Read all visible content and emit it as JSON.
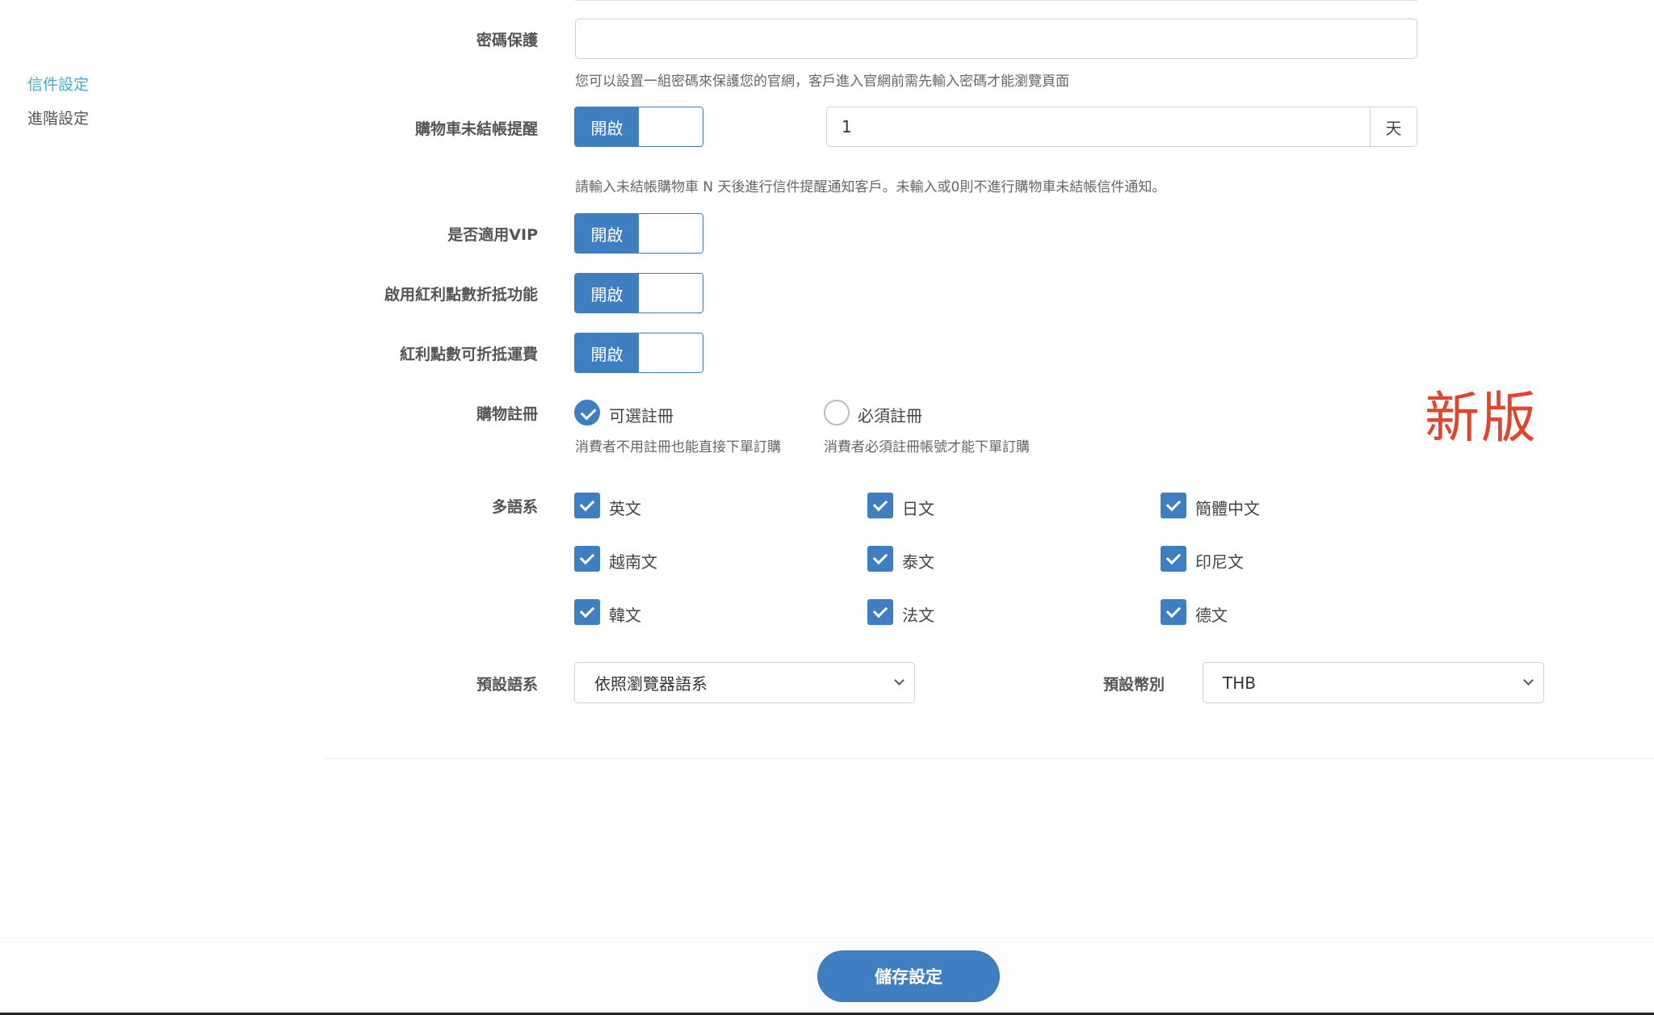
{
  "sidebar": {
    "items": [
      {
        "label": "信件設定",
        "active": true
      },
      {
        "label": "進階設定",
        "active": false
      }
    ]
  },
  "form": {
    "password": {
      "label": "密碼保護",
      "value": "",
      "help": "您可以設置一組密碼來保護您的官網，客戶進入官網前需先輸入密碼才能瀏覽頁面"
    },
    "cart_reminder": {
      "label": "購物車未結帳提醒",
      "toggle_label": "開啟",
      "days_value": "1",
      "days_unit": "天",
      "help": "請輸入未結帳購物車 N 天後進行信件提醒通知客戶。未輸入或0則不進行購物車未結帳信件通知。"
    },
    "vip": {
      "label": "是否適用VIP",
      "toggle_label": "開啟"
    },
    "bonus_points": {
      "label": "啟用紅利點數折抵功能",
      "toggle_label": "開啟"
    },
    "bonus_shipping": {
      "label": "紅利點數可折抵運費",
      "toggle_label": "開啟"
    },
    "registration": {
      "label": "購物註冊",
      "options": [
        {
          "label": "可選註冊",
          "desc": "消費者不用註冊也能直接下單訂購",
          "selected": true
        },
        {
          "label": "必須註冊",
          "desc": "消費者必須註冊帳號才能下單訂購",
          "selected": false
        }
      ]
    },
    "languages": {
      "label": "多語系",
      "items": [
        {
          "label": "英文",
          "checked": true
        },
        {
          "label": "日文",
          "checked": true
        },
        {
          "label": "簡體中文",
          "checked": true
        },
        {
          "label": "越南文",
          "checked": true
        },
        {
          "label": "泰文",
          "checked": true
        },
        {
          "label": "印尼文",
          "checked": true
        },
        {
          "label": "韓文",
          "checked": true
        },
        {
          "label": "法文",
          "checked": true
        },
        {
          "label": "德文",
          "checked": true
        }
      ]
    },
    "default_language": {
      "label": "預設語系",
      "selected": "依照瀏覽器語系"
    },
    "default_currency": {
      "label": "預設幣別",
      "selected": "THB"
    }
  },
  "annotation": {
    "text": "新版",
    "color": "#e0452d"
  },
  "footer": {
    "save_label": "儲存設定"
  },
  "colors": {
    "accent": "#3f7ec0",
    "sidebar_active": "#4aa8c8"
  }
}
